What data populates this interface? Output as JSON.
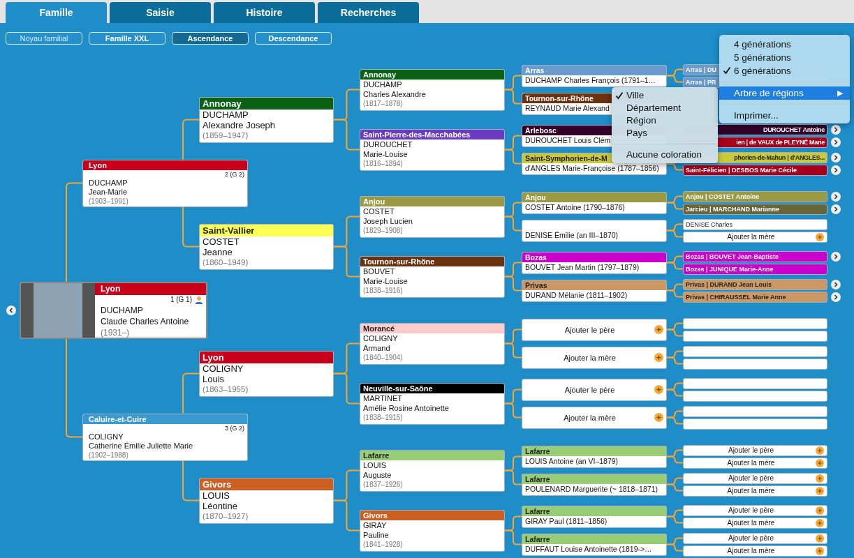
{
  "tabs": [
    {
      "label": "Famille",
      "selected": true
    },
    {
      "label": "Saisie",
      "selected": false
    },
    {
      "label": "Histoire",
      "selected": false
    },
    {
      "label": "Recherches",
      "selected": false
    }
  ],
  "views": [
    {
      "label": "Noyau familial",
      "selected": false,
      "disabled": true
    },
    {
      "label": "Famille XXL",
      "selected": false,
      "disabled": false
    },
    {
      "label": "Ascendance",
      "selected": true,
      "disabled": false
    },
    {
      "label": "Descendance",
      "selected": false,
      "disabled": false
    }
  ],
  "pedigree": {
    "person": {
      "kind": "person",
      "place": "Lyon",
      "color": "#c8001a",
      "number": "1 (G 1)",
      "surname": "DUCHAMP",
      "given": "Claude Charles Antoine",
      "dates": "(1931–)",
      "parents": [
        {
          "kind": "person",
          "place": "Lyon",
          "color": "#c8001a",
          "number": "2 (G 2)",
          "surname": "DUCHAMP",
          "given": "Jean-Marie",
          "dates": "(1903–1991)",
          "parents": [
            {
              "kind": "person",
              "place": "Annonay",
              "color": "#0a6114",
              "surname": "DUCHAMP",
              "given": "Alexandre Joseph",
              "dates": "(1859–1947)",
              "parents": [
                {
                  "kind": "person",
                  "place": "Annonay",
                  "color": "#0a6114",
                  "surname": "DUCHAMP",
                  "given": "Charles Alexandre",
                  "dates": "(1817–1878)",
                  "parents": [
                    {
                      "kind": "person",
                      "place": "Arras",
                      "color": "#6b9bcc",
                      "text": "DUCHAMP Charles François (1791–1…",
                      "parents": [
                        {
                          "kind": "person",
                          "text": "Arras | DU",
                          "color": "#6b9bcc",
                          "more": false
                        },
                        {
                          "kind": "person",
                          "text": "Arras | PR",
                          "color": "#6b9bcc",
                          "more": false
                        }
                      ]
                    },
                    {
                      "kind": "person",
                      "place": "Tournon-sur-Rhône",
                      "color": "#6b3210",
                      "text": "REYNAUD Marie Alexand"
                    }
                  ]
                },
                {
                  "kind": "person",
                  "place": "Saint-Pierre-des-Macchabées",
                  "color": "#6a3ac0",
                  "surname": "DUROUCHET",
                  "given": "Marie-Louise",
                  "dates": "(1816–1894)",
                  "parents": [
                    {
                      "kind": "person",
                      "place": "Arlebosc",
                      "color": "#33002a",
                      "text": "DUROUCHET Louis Clém",
                      "parents": [
                        {
                          "kind": "partial",
                          "text": "DUROUCHET Antoine",
                          "color": "#33002a",
                          "more": true
                        },
                        {
                          "kind": "partial",
                          "text": "ien | de VAUX de PLEYNÉ Marie",
                          "color": "#a8001c",
                          "more": true
                        }
                      ]
                    },
                    {
                      "kind": "person",
                      "place": "Saint-Symphorien-de-M",
                      "color": "#c9c93a",
                      "text": "d'ANGLES Marie-Françoise (1787–1856)",
                      "parents": [
                        {
                          "kind": "partial",
                          "text": "phorien-de-Mahun | d'ANGLES...",
                          "color": "#c9c93a",
                          "more": true
                        },
                        {
                          "kind": "person",
                          "text": "Saint-Félicien | DESBOS Marie Cécile",
                          "color": "#a8001c",
                          "more": true
                        }
                      ]
                    }
                  ]
                }
              ]
            },
            {
              "kind": "person",
              "place": "Saint-Vallier",
              "color": "#ffff55",
              "surname": "COSTET",
              "given": "Jeanne",
              "dates": "(1860–1949)",
              "parents": [
                {
                  "kind": "person",
                  "place": "Anjou",
                  "color": "#9a9a44",
                  "surname": "COSTET",
                  "given": "Joseph Lucien",
                  "dates": "(1829–1908)",
                  "parents": [
                    {
                      "kind": "person",
                      "place": "Anjou",
                      "color": "#9a9a44",
                      "text": "COSTET Antoine (1790–1876)",
                      "parents": [
                        {
                          "kind": "person",
                          "text": "Anjou | COSTET Antoine",
                          "color": "#9a9a44",
                          "more": true
                        },
                        {
                          "kind": "person",
                          "text": "Jarcieu | MARCHAND Marianne",
                          "color": "#66663a",
                          "more": true
                        }
                      ]
                    },
                    {
                      "kind": "person",
                      "text": "DENISE Émilie (an III–1870)",
                      "parents": [
                        {
                          "kind": "person",
                          "text": "DENISE Charles",
                          "more": false
                        },
                        {
                          "kind": "add",
                          "label": "Ajouter la mère"
                        }
                      ]
                    }
                  ]
                },
                {
                  "kind": "person",
                  "place": "Tournon-sur-Rhône",
                  "color": "#6b3210",
                  "surname": "BOUVET",
                  "given": "Marie-Louise",
                  "dates": "(1838–1916)",
                  "parents": [
                    {
                      "kind": "person",
                      "place": "Bozas",
                      "color": "#cc00cc",
                      "text": "BOUVET Jean Martin (1797–1879)",
                      "parents": [
                        {
                          "kind": "person",
                          "text": "Bozas | BOUVET Jean-Baptiste",
                          "color": "#cc00cc",
                          "more": true
                        },
                        {
                          "kind": "person",
                          "text": "Bozas | JUNIQUE Marie-Anne",
                          "color": "#cc00cc",
                          "more": false
                        }
                      ]
                    },
                    {
                      "kind": "person",
                      "place": "Privas",
                      "color": "#cc9966",
                      "text": "DURAND Mélanie (1811–1902)",
                      "parents": [
                        {
                          "kind": "person",
                          "text": "Privas | DURAND Jean Louis",
                          "color": "#cc9966",
                          "more": true
                        },
                        {
                          "kind": "person",
                          "text": "Privas | CHIRAUSSEL Marie Anne",
                          "color": "#cc9966",
                          "more": true
                        }
                      ]
                    }
                  ]
                }
              ]
            }
          ]
        },
        {
          "kind": "person",
          "place": "Caluire-et-Cuire",
          "color": "#3a9ad0",
          "number": "3 (G 2)",
          "surname": "COLIGNY",
          "given": "Catherine Émilie Juliette Marie",
          "dates": "(1902–1988)",
          "parents": [
            {
              "kind": "person",
              "place": "Lyon",
              "color": "#c8001a",
              "surname": "COLIGNY",
              "given": "Louis",
              "dates": "(1863–1955)",
              "parents": [
                {
                  "kind": "person",
                  "place": "Morancé",
                  "color": "#ffcccc",
                  "surname": "COLIGNY",
                  "given": "Armand",
                  "dates": "(1840–1904)",
                  "parents": [
                    {
                      "kind": "add",
                      "label": "Ajouter le père",
                      "parents": [
                        {
                          "kind": "empty"
                        },
                        {
                          "kind": "empty"
                        }
                      ]
                    },
                    {
                      "kind": "add",
                      "label": "Ajouter la mère",
                      "parents": [
                        {
                          "kind": "empty"
                        },
                        {
                          "kind": "empty"
                        }
                      ]
                    }
                  ]
                },
                {
                  "kind": "person",
                  "place": "Neuville-sur-Saône",
                  "color": "#000000",
                  "surname": "MARTINET",
                  "given": "Amélie Rosine Antoinette",
                  "dates": "(1838–1915)",
                  "parents": [
                    {
                      "kind": "add",
                      "label": "Ajouter le père",
                      "parents": [
                        {
                          "kind": "empty"
                        },
                        {
                          "kind": "empty"
                        }
                      ]
                    },
                    {
                      "kind": "add",
                      "label": "Ajouter la mère",
                      "parents": [
                        {
                          "kind": "empty"
                        },
                        {
                          "kind": "empty"
                        }
                      ]
                    }
                  ]
                }
              ]
            },
            {
              "kind": "person",
              "place": "Givors",
              "color": "#cc6022",
              "surname": "LOUIS",
              "given": "Léontine",
              "dates": "(1870–1927)",
              "parents": [
                {
                  "kind": "person",
                  "place": "Lafarre",
                  "color": "#99cc77",
                  "surname": "LOUIS",
                  "given": "Auguste",
                  "dates": "(1837–1926)",
                  "parents": [
                    {
                      "kind": "person",
                      "place": "Lafarre",
                      "color": "#99cc77",
                      "text": "LOUIS Antoine (an VI–1879)",
                      "parents": [
                        {
                          "kind": "add",
                          "label": "Ajouter le père"
                        },
                        {
                          "kind": "add",
                          "label": "Ajouter la mère"
                        }
                      ]
                    },
                    {
                      "kind": "person",
                      "place": "Lafarre",
                      "color": "#99cc77",
                      "text": "POULENARD Marguerite (~ 1818–1871)",
                      "parents": [
                        {
                          "kind": "add",
                          "label": "Ajouter le père"
                        },
                        {
                          "kind": "add",
                          "label": "Ajouter la mère"
                        }
                      ]
                    }
                  ]
                },
                {
                  "kind": "person",
                  "place": "Givors",
                  "color": "#cc6022",
                  "surname": "GIRAY",
                  "given": "Pauline",
                  "dates": "(1841–1928)",
                  "parents": [
                    {
                      "kind": "person",
                      "place": "Lafarre",
                      "color": "#99cc77",
                      "text": "GIRAY Paul (1811–1856)",
                      "parents": [
                        {
                          "kind": "add",
                          "label": "Ajouter le père"
                        },
                        {
                          "kind": "add",
                          "label": "Ajouter la mère"
                        }
                      ]
                    },
                    {
                      "kind": "person",
                      "place": "Lafarre",
                      "color": "#99cc77",
                      "text": "DUFFAUT Louise Antoinette (1819->…",
                      "parents": [
                        {
                          "kind": "add",
                          "label": "Ajouter le père"
                        },
                        {
                          "kind": "add",
                          "label": "Ajouter la mère"
                        }
                      ]
                    }
                  ]
                }
              ]
            }
          ]
        }
      ]
    }
  },
  "menu": {
    "items": [
      {
        "kind": "option",
        "label": "4 générations",
        "checked": false
      },
      {
        "kind": "option",
        "label": "5 générations",
        "checked": false
      },
      {
        "kind": "option",
        "label": "6 générations",
        "checked": true
      },
      {
        "kind": "separator"
      },
      {
        "kind": "submenu",
        "label": "Arbre de régions",
        "arrow": "▶",
        "selected": true
      },
      {
        "kind": "separator"
      },
      {
        "kind": "option",
        "label": "Imprimer...",
        "checked": false
      }
    ]
  },
  "submenu": {
    "items": [
      {
        "kind": "option",
        "label": "Ville",
        "checked": true
      },
      {
        "kind": "option",
        "label": "Département",
        "checked": false
      },
      {
        "kind": "option",
        "label": "Région",
        "checked": false
      },
      {
        "kind": "option",
        "label": "Pays",
        "checked": false
      },
      {
        "kind": "separator"
      },
      {
        "kind": "option",
        "label": "Aucune coloration",
        "checked": false
      }
    ]
  }
}
